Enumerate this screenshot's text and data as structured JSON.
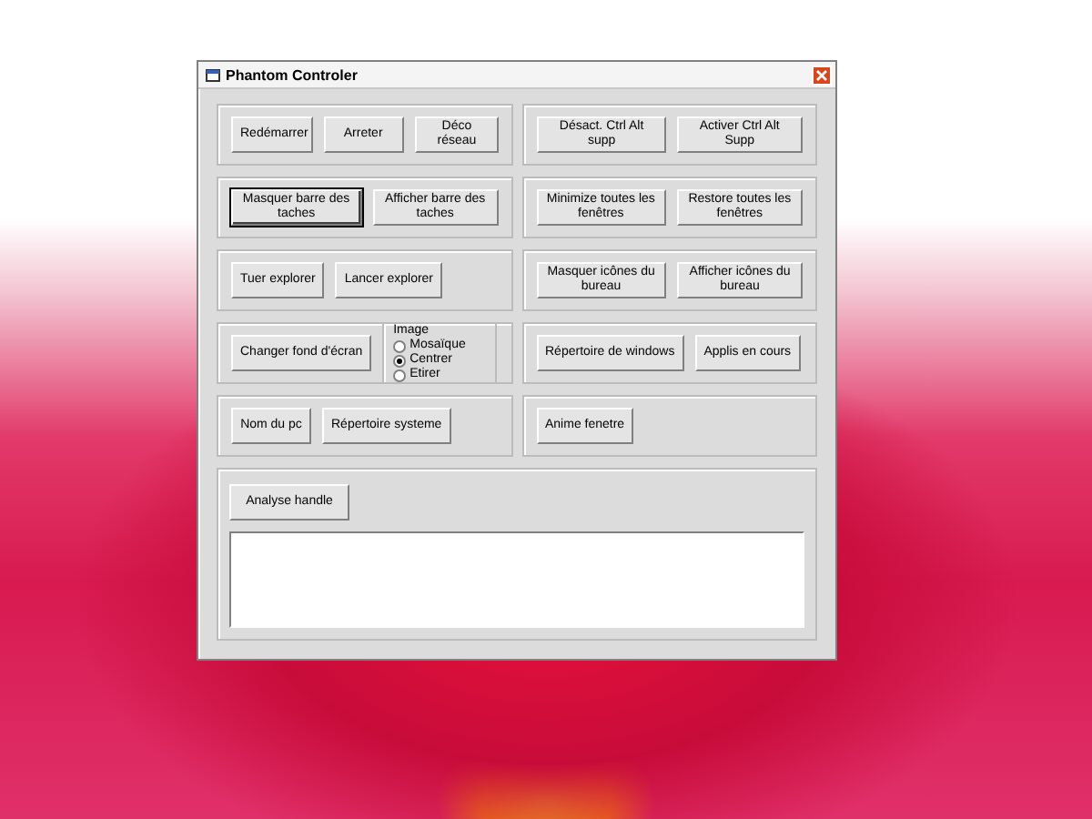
{
  "window": {
    "title": "Phantom Controler"
  },
  "rows": [
    {
      "panels": [
        {
          "items": [
            {
              "kind": "button",
              "label": "Redémarrer",
              "focused": false
            },
            {
              "kind": "button",
              "label": "Arreter",
              "focused": false
            },
            {
              "kind": "button",
              "label": "Déco réseau",
              "focused": false
            }
          ]
        },
        {
          "items": [
            {
              "kind": "button",
              "label": "Désact. Ctrl Alt supp",
              "focused": false
            },
            {
              "kind": "button",
              "label": "Activer Ctrl Alt Supp",
              "focused": false
            }
          ]
        }
      ]
    },
    {
      "panels": [
        {
          "items": [
            {
              "kind": "button",
              "label": "Masquer barre des taches",
              "focused": true
            },
            {
              "kind": "button",
              "label": "Afficher barre des taches",
              "focused": false
            }
          ]
        },
        {
          "items": [
            {
              "kind": "button",
              "label": "Minimize toutes les fenêtres",
              "focused": false
            },
            {
              "kind": "button",
              "label": "Restore toutes les fenêtres",
              "focused": false
            }
          ]
        }
      ]
    },
    {
      "panels": [
        {
          "items": [
            {
              "kind": "button",
              "label": "Tuer explorer",
              "focused": false
            },
            {
              "kind": "button",
              "label": "Lancer explorer",
              "focused": false
            }
          ]
        },
        {
          "items": [
            {
              "kind": "button",
              "label": "Masquer icônes du bureau",
              "focused": false
            },
            {
              "kind": "button",
              "label": "Afficher  icônes du bureau",
              "focused": false
            }
          ]
        }
      ]
    },
    {
      "panels": [
        {
          "items": [
            {
              "kind": "button",
              "label": "Changer fond d'écran",
              "focused": false
            },
            {
              "kind": "radio-group",
              "label": "Image",
              "options": [
                {
                  "label": "Mosaïque",
                  "selected": false
                },
                {
                  "label": "Centrer",
                  "selected": true
                },
                {
                  "label": "Etirer",
                  "selected": false
                }
              ]
            }
          ]
        },
        {
          "items": [
            {
              "kind": "button",
              "label": "Répertoire de windows",
              "focused": false
            },
            {
              "kind": "button",
              "label": "Applis en cours",
              "focused": false
            }
          ]
        }
      ]
    },
    {
      "panels": [
        {
          "items": [
            {
              "kind": "button",
              "label": "Nom du pc",
              "focused": false
            },
            {
              "kind": "button",
              "label": "Répertoire systeme",
              "focused": false
            }
          ]
        },
        {
          "items": [
            {
              "kind": "button",
              "label": "Anime fenetre",
              "focused": false
            }
          ]
        }
      ]
    }
  ],
  "handle_panel": {
    "button": {
      "label": "Analyse handle"
    }
  }
}
